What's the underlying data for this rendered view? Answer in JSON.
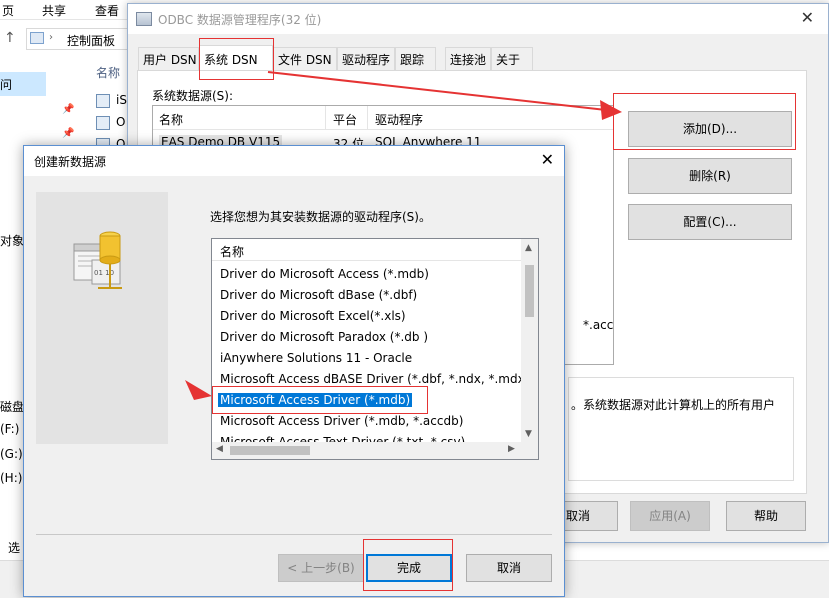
{
  "explorer": {
    "ribbon_tabs": [
      "页",
      "共享",
      "查看"
    ],
    "breadcrumb": "控制面板",
    "column_name": "名称",
    "sidebar_selected": "问",
    "files": [
      "iS",
      "O",
      "O"
    ],
    "sidebar": [
      "对象",
      "磁盘",
      "(F:)",
      "(G:)",
      "(H:)",
      "选"
    ]
  },
  "odbc": {
    "title": "ODBC 数据源管理程序(32 位)",
    "close": "✕",
    "tabs": [
      "用户 DSN",
      "系统 DSN",
      "文件 DSN",
      "驱动程序",
      "跟踪",
      "连接池",
      "关于"
    ],
    "system_sources_label": "系统数据源(S):",
    "columns": [
      "名称",
      "平台",
      "驱动程序"
    ],
    "rows": [
      {
        "name": "EAS Demo DB V115",
        "platform": "32 位",
        "driver": "SQL Anywhere 11"
      }
    ],
    "driver_fragment": "*.accdb)",
    "buttons": {
      "add": "添加(D)...",
      "remove": "删除(R)",
      "configure": "配置(C)..."
    },
    "description_fragment": "。系统数据源对此计算机上的所有用户",
    "bottom": {
      "cancel": "取消",
      "apply": "应用(A)",
      "help": "帮助"
    }
  },
  "dialog": {
    "title": "创建新数据源",
    "close": "✕",
    "prompt": "选择您想为其安装数据源的驱动程序(S)。",
    "list_header": "名称",
    "drivers": [
      "Driver do Microsoft Access (*.mdb)",
      "Driver do Microsoft dBase (*.dbf)",
      "Driver do Microsoft Excel(*.xls)",
      "Driver do Microsoft Paradox (*.db )",
      "iAnywhere Solutions 11 - Oracle",
      "Microsoft Access dBASE Driver (*.dbf, *.ndx, *.mdx)",
      "Microsoft Access Driver (*.mdb)",
      "Microsoft Access Driver (*.mdb, *.accdb)",
      "Microsoft Access Text Driver (*.txt, *.csv)"
    ],
    "selected_index": 6,
    "buttons": {
      "back": "< 上一步(B)",
      "finish": "完成",
      "cancel": "取消"
    },
    "icon_text": "01 10"
  },
  "colors": {
    "annotation_red": "#e53333",
    "selection_blue": "#0078d7"
  }
}
